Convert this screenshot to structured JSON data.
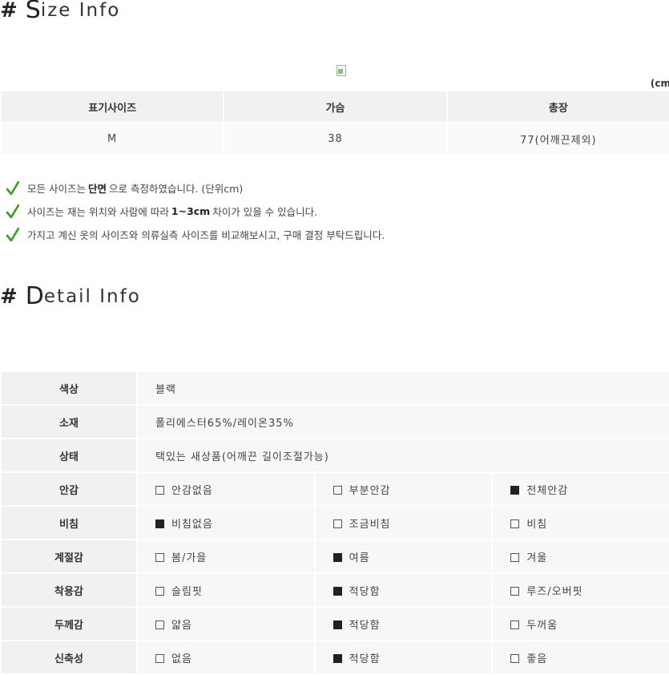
{
  "size_section": {
    "hash": "#",
    "title_first": "S",
    "title_rest": "ize Info",
    "unit_note": "(cm",
    "headers": [
      "표기사이즈",
      "가슴",
      "총장"
    ],
    "rows": [
      [
        "M",
        "38",
        "77(어깨끈제외)"
      ]
    ]
  },
  "notes": [
    {
      "before": "모든 사이즈는",
      "bold": "단면",
      "after": "으로 측정하였습니다. (단위cm)"
    },
    {
      "before": "사이즈는 재는 위치와 사람에 따라",
      "bold": "1~3cm",
      "after": "차이가 있을 수 있습니다."
    },
    {
      "before": "가지고 계신 옷의 사이즈와 의류실측 사이즈를 비교해보시고, 구매 결정 부탁드립니다.",
      "bold": "",
      "after": ""
    }
  ],
  "detail_section": {
    "hash": "#",
    "title_first": "D",
    "title_rest": "etail Info",
    "info_rows": [
      {
        "label": "색상",
        "value": "블랙"
      },
      {
        "label": "소재",
        "value": "폴리에스터65%/레이온35%"
      },
      {
        "label": "상태",
        "value": "택있는 새상품(어깨끈 길이조절가능)"
      }
    ],
    "option_rows": [
      {
        "label": "안감",
        "options": [
          {
            "text": "안감없음",
            "checked": false
          },
          {
            "text": "부분안감",
            "checked": false
          },
          {
            "text": "전체안감",
            "checked": true
          }
        ]
      },
      {
        "label": "비침",
        "options": [
          {
            "text": "비침없음",
            "checked": true
          },
          {
            "text": "조금비침",
            "checked": false
          },
          {
            "text": "비침",
            "checked": false
          }
        ]
      },
      {
        "label": "계절감",
        "options": [
          {
            "text": "봄/가을",
            "checked": false
          },
          {
            "text": "여름",
            "checked": true
          },
          {
            "text": "겨울",
            "checked": false
          }
        ]
      },
      {
        "label": "착용감",
        "options": [
          {
            "text": "슬림핏",
            "checked": false
          },
          {
            "text": "적당함",
            "checked": true
          },
          {
            "text": "루즈/오버핏",
            "checked": false
          }
        ]
      },
      {
        "label": "두께감",
        "options": [
          {
            "text": "얇음",
            "checked": false
          },
          {
            "text": "적당함",
            "checked": true
          },
          {
            "text": "두꺼움",
            "checked": false
          }
        ]
      },
      {
        "label": "신축성",
        "options": [
          {
            "text": "없음",
            "checked": false
          },
          {
            "text": "적당함",
            "checked": true
          },
          {
            "text": "좋음",
            "checked": false
          }
        ]
      }
    ]
  },
  "colors": {
    "check_green": "#3a9d23",
    "header_bg": "#f1f1f1",
    "cell_bg": "#f7f7f7"
  }
}
